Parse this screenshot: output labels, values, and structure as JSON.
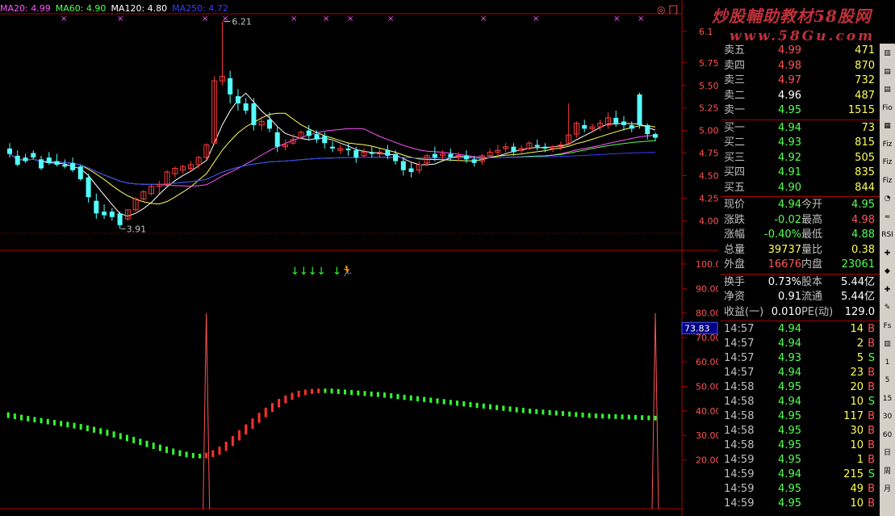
{
  "ma_legend": [
    {
      "label": "MA20: 4.99",
      "color": "#ff54ff"
    },
    {
      "label": "MA60: 4.90",
      "color": "#54ff54"
    },
    {
      "label": "MA120: 4.80",
      "color": "#ffffff"
    },
    {
      "label": "MA250: 4.72",
      "color": "#3c3cff"
    }
  ],
  "watermark": {
    "line1": "炒股輔助教材58股网",
    "line2": "www.58Gu.com"
  },
  "corner_mark": "◎ 冂",
  "chart_data": [
    {
      "type": "line",
      "title": "",
      "ylim": [
        3.85,
        6.25
      ],
      "y_ticks": [
        "6.1",
        "5.75",
        "5.50",
        "5.25",
        "5.00",
        "4.75",
        "4.50",
        "4.25",
        "4.00"
      ],
      "y_tick_values": [
        6.1,
        5.75,
        5.5,
        5.25,
        5.0,
        4.75,
        4.5,
        4.25,
        4.0
      ],
      "annotations": [
        {
          "label": "6.21",
          "value": 6.21
        },
        {
          "label": "3.91",
          "value": 3.91
        }
      ],
      "candles": [
        [
          4.8,
          4.86,
          4.74,
          4.7
        ],
        [
          4.72,
          4.78,
          4.62,
          4.6
        ],
        [
          4.7,
          4.74,
          4.66,
          4.64
        ],
        [
          4.75,
          4.78,
          4.7,
          4.68
        ],
        [
          4.68,
          4.72,
          4.58,
          4.56
        ],
        [
          4.7,
          4.76,
          4.64,
          4.62
        ],
        [
          4.66,
          4.74,
          4.62,
          4.6
        ],
        [
          4.62,
          4.68,
          4.6,
          4.58
        ],
        [
          4.64,
          4.7,
          4.56,
          4.54
        ],
        [
          4.6,
          4.62,
          4.46,
          4.44
        ],
        [
          4.48,
          4.52,
          4.26,
          4.2
        ],
        [
          4.22,
          4.3,
          4.08,
          4.02
        ],
        [
          4.1,
          4.18,
          4.06,
          4.02
        ],
        [
          4.1,
          4.14,
          4.04,
          4.0
        ],
        [
          4.08,
          4.1,
          3.95,
          3.91
        ],
        [
          4.02,
          4.12,
          4.12,
          4.0
        ],
        [
          4.12,
          4.26,
          4.24,
          4.1
        ],
        [
          4.24,
          4.34,
          4.32,
          4.22
        ],
        [
          4.3,
          4.4,
          4.38,
          4.28
        ],
        [
          4.38,
          4.44,
          4.4,
          4.3
        ],
        [
          4.4,
          4.56,
          4.54,
          4.38
        ],
        [
          4.52,
          4.6,
          4.58,
          4.48
        ],
        [
          4.56,
          4.62,
          4.6,
          4.52
        ],
        [
          4.58,
          4.66,
          4.62,
          4.54
        ],
        [
          4.62,
          4.72,
          4.7,
          4.58
        ],
        [
          4.7,
          4.86,
          4.84,
          4.68
        ],
        [
          4.86,
          5.6,
          5.55,
          4.84
        ],
        [
          5.55,
          6.21,
          5.6,
          5.5
        ],
        [
          5.58,
          5.66,
          5.4,
          5.3
        ],
        [
          5.38,
          5.46,
          5.3,
          5.22
        ],
        [
          5.3,
          5.36,
          5.22,
          5.18
        ],
        [
          5.3,
          5.36,
          5.06,
          5.0
        ],
        [
          5.06,
          5.16,
          5.1,
          5.0
        ],
        [
          5.12,
          5.2,
          5.02,
          4.98
        ],
        [
          4.98,
          5.04,
          4.82,
          4.76
        ],
        [
          4.82,
          4.9,
          4.84,
          4.78
        ],
        [
          4.86,
          4.96,
          4.9,
          4.84
        ],
        [
          4.92,
          5.0,
          4.98,
          4.9
        ],
        [
          5.0,
          5.06,
          4.94,
          4.9
        ],
        [
          4.96,
          5.0,
          4.9,
          4.86
        ],
        [
          4.94,
          4.98,
          4.86,
          4.8
        ],
        [
          4.82,
          4.88,
          4.8,
          4.76
        ],
        [
          4.78,
          4.84,
          4.8,
          4.74
        ],
        [
          4.8,
          4.86,
          4.78,
          4.72
        ],
        [
          4.78,
          4.82,
          4.7,
          4.64
        ],
        [
          4.72,
          4.8,
          4.76,
          4.7
        ],
        [
          4.76,
          4.82,
          4.74,
          4.7
        ],
        [
          4.74,
          4.8,
          4.76,
          4.7
        ],
        [
          4.78,
          4.84,
          4.72,
          4.68
        ],
        [
          4.74,
          4.78,
          4.66,
          4.62
        ],
        [
          4.66,
          4.7,
          4.56,
          4.5
        ],
        [
          4.58,
          4.64,
          4.54,
          4.48
        ],
        [
          4.56,
          4.66,
          4.62,
          4.52
        ],
        [
          4.64,
          4.74,
          4.72,
          4.6
        ],
        [
          4.74,
          4.82,
          4.7,
          4.66
        ],
        [
          4.72,
          4.78,
          4.74,
          4.68
        ],
        [
          4.74,
          4.8,
          4.7,
          4.66
        ],
        [
          4.7,
          4.76,
          4.72,
          4.66
        ],
        [
          4.72,
          4.78,
          4.68,
          4.64
        ],
        [
          4.68,
          4.72,
          4.64,
          4.6
        ],
        [
          4.66,
          4.74,
          4.72,
          4.62
        ],
        [
          4.72,
          4.8,
          4.76,
          4.7
        ],
        [
          4.76,
          4.84,
          4.78,
          4.72
        ],
        [
          4.8,
          4.86,
          4.82,
          4.76
        ],
        [
          4.82,
          4.86,
          4.76,
          4.72
        ],
        [
          4.78,
          4.84,
          4.8,
          4.74
        ],
        [
          4.8,
          4.88,
          4.86,
          4.78
        ],
        [
          4.84,
          4.9,
          4.82,
          4.78
        ],
        [
          4.82,
          4.86,
          4.8,
          4.76
        ],
        [
          4.8,
          4.84,
          4.82,
          4.76
        ],
        [
          4.82,
          4.88,
          4.84,
          4.78
        ],
        [
          4.86,
          5.3,
          4.95,
          4.84
        ],
        [
          4.96,
          5.1,
          5.08,
          4.92
        ],
        [
          5.06,
          5.12,
          5.02,
          4.98
        ],
        [
          5.02,
          5.08,
          5.04,
          4.98
        ],
        [
          5.04,
          5.12,
          5.08,
          5.0
        ],
        [
          5.06,
          5.2,
          5.14,
          5.02
        ],
        [
          5.14,
          5.22,
          5.08,
          5.04
        ],
        [
          5.1,
          5.16,
          5.06,
          5.0
        ],
        [
          5.06,
          5.1,
          5.02,
          4.98
        ],
        [
          5.4,
          5.42,
          5.06,
          5.02
        ],
        [
          5.06,
          5.08,
          4.96,
          4.9
        ],
        [
          4.96,
          4.98,
          4.92,
          4.88
        ]
      ],
      "series": []
    },
    {
      "type": "bar",
      "ylim": [
        0,
        100
      ],
      "y_ticks": [
        "100.0",
        "90.00",
        "80.00",
        "70.00",
        "60.00",
        "50.00",
        "40.00",
        "30.00",
        "20.00"
      ],
      "y_tick_values": [
        100,
        90,
        80,
        70,
        60,
        50,
        40,
        30,
        20
      ],
      "current_value_label": "73.83",
      "values": [
        38.5,
        38.0,
        37.5,
        37.0,
        36.6,
        36.2,
        35.8,
        35.4,
        35.0,
        34.6,
        34.2,
        33.7,
        33.2,
        32.6,
        32.0,
        31.4,
        30.7,
        30.0,
        29.3,
        28.5,
        27.7,
        26.9,
        26.1,
        25.3,
        24.5,
        23.7,
        23.0,
        22.4,
        21.9,
        21.6,
        21.5,
        22.0,
        23.0,
        24.5,
        26.5,
        28.8,
        31.2,
        33.6,
        36.0,
        38.3,
        40.4,
        42.3,
        44.0,
        45.4,
        46.5,
        47.3,
        47.8,
        48.1,
        48.2,
        48.2,
        48.0,
        47.8,
        47.6,
        47.4,
        47.2,
        47.0,
        46.8,
        46.6,
        46.3,
        46.0,
        45.7,
        45.4,
        45.1,
        44.8,
        44.5,
        44.2,
        43.9,
        43.6,
        43.3,
        43.0,
        42.7,
        42.4,
        42.1,
        41.8,
        41.5,
        41.2,
        40.9,
        40.6,
        40.3,
        40.0,
        39.8,
        39.6,
        39.4,
        39.2,
        39.0,
        38.8,
        38.6,
        38.4,
        38.2,
        38.0,
        37.9,
        37.8,
        37.7,
        37.6,
        37.5,
        37.4,
        37.3,
        37.2,
        37.1,
        37.0
      ],
      "spikes": [
        {
          "index": 31,
          "value": 80
        },
        {
          "index": 99,
          "value": 80
        }
      ],
      "signal_arrows": "↓↓↓↓",
      "signal_arrow2": "↓",
      "signal_icon": "runner-icon"
    }
  ],
  "quote": {
    "sell": [
      {
        "label": "卖五",
        "price": "4.99",
        "vol": "471",
        "color": "red"
      },
      {
        "label": "卖四",
        "price": "4.98",
        "vol": "870",
        "color": "red"
      },
      {
        "label": "卖三",
        "price": "4.97",
        "vol": "732",
        "color": "red"
      },
      {
        "label": "卖二",
        "price": "4.96",
        "vol": "487",
        "color": "white"
      },
      {
        "label": "卖一",
        "price": "4.95",
        "vol": "1515",
        "color": "green"
      }
    ],
    "buy": [
      {
        "label": "买一",
        "price": "4.94",
        "vol": "73",
        "color": "green"
      },
      {
        "label": "买二",
        "price": "4.93",
        "vol": "815",
        "color": "green"
      },
      {
        "label": "买三",
        "price": "4.92",
        "vol": "505",
        "color": "green"
      },
      {
        "label": "买四",
        "price": "4.91",
        "vol": "835",
        "color": "green"
      },
      {
        "label": "买五",
        "price": "4.90",
        "vol": "844",
        "color": "green"
      }
    ],
    "stats1": [
      {
        "l1": "现价",
        "v1": "4.94",
        "c1": "green",
        "l2": "今开",
        "v2": "4.95",
        "c2": "green"
      },
      {
        "l1": "涨跌",
        "v1": "-0.02",
        "c1": "green",
        "l2": "最高",
        "v2": "4.98",
        "c2": "red"
      },
      {
        "l1": "涨幅",
        "v1": "-0.40%",
        "c1": "green",
        "l2": "最低",
        "v2": "4.88",
        "c2": "green"
      },
      {
        "l1": "总量",
        "v1": "39737",
        "c1": "yellow",
        "l2": "量比",
        "v2": "0.38",
        "c2": "yellow"
      },
      {
        "l1": "外盘",
        "v1": "16676",
        "c1": "red",
        "l2": "内盘",
        "v2": "23061",
        "c2": "green"
      }
    ],
    "stats2": [
      {
        "l1": "换手",
        "v1": "0.73%",
        "l2": "股本",
        "v2": "5.44亿"
      },
      {
        "l1": "净资",
        "v1": "0.91",
        "l2": "流通",
        "v2": "5.44亿"
      },
      {
        "l1": "收益(一)",
        "v1": "0.010",
        "l2": "PE(动)",
        "v2": "129.0"
      }
    ],
    "ticks": [
      {
        "t": "14:57",
        "p": "4.94",
        "pc": "green",
        "v": "14",
        "bs": "B",
        "bc": "red"
      },
      {
        "t": "14:57",
        "p": "4.94",
        "pc": "green",
        "v": "2",
        "bs": "B",
        "bc": "red"
      },
      {
        "t": "14:57",
        "p": "4.93",
        "pc": "green",
        "v": "5",
        "bs": "S",
        "bc": "green"
      },
      {
        "t": "14:57",
        "p": "4.94",
        "pc": "green",
        "v": "23",
        "bs": "B",
        "bc": "red"
      },
      {
        "t": "14:58",
        "p": "4.95",
        "pc": "green",
        "v": "20",
        "bs": "B",
        "bc": "red"
      },
      {
        "t": "14:58",
        "p": "4.94",
        "pc": "green",
        "v": "10",
        "bs": "S",
        "bc": "green"
      },
      {
        "t": "14:58",
        "p": "4.95",
        "pc": "green",
        "v": "117",
        "bs": "B",
        "bc": "red"
      },
      {
        "t": "14:58",
        "p": "4.95",
        "pc": "green",
        "v": "30",
        "bs": "B",
        "bc": "red"
      },
      {
        "t": "14:58",
        "p": "4.95",
        "pc": "green",
        "v": "10",
        "bs": "B",
        "bc": "red"
      },
      {
        "t": "14:59",
        "p": "4.95",
        "pc": "green",
        "v": "1",
        "bs": "B",
        "bc": "red"
      },
      {
        "t": "14:59",
        "p": "4.94",
        "pc": "green",
        "v": "215",
        "bs": "S",
        "bc": "green"
      },
      {
        "t": "14:59",
        "p": "4.95",
        "pc": "green",
        "v": "49",
        "bs": "B",
        "bc": "red"
      },
      {
        "t": "14:59",
        "p": "4.95",
        "pc": "green",
        "v": "10",
        "bs": "B",
        "bc": "red"
      }
    ]
  },
  "toolbar": [
    "chart-icon",
    "bars-icon",
    "bars-icon",
    "Fio",
    "grid-icon",
    "Fiz",
    "Fiz",
    "Fiz",
    "gauge-icon",
    "wave-icon",
    "RSI",
    "plus-icon",
    "diamond-icon",
    "plus-icon",
    "pencil-icon",
    "Fs",
    "chart-icon",
    "1",
    "5",
    "15",
    "30",
    "60",
    "日",
    "周",
    "月"
  ],
  "colors": {
    "up": "#ff3c3c",
    "down": "#54ffff",
    "ma_white": "#ffffff",
    "ma_yellow": "#ffff54",
    "ma_purple": "#ff54ff",
    "ma_green": "#54ff54",
    "ma_blue": "#3c3cff",
    "border": "#b00000"
  }
}
